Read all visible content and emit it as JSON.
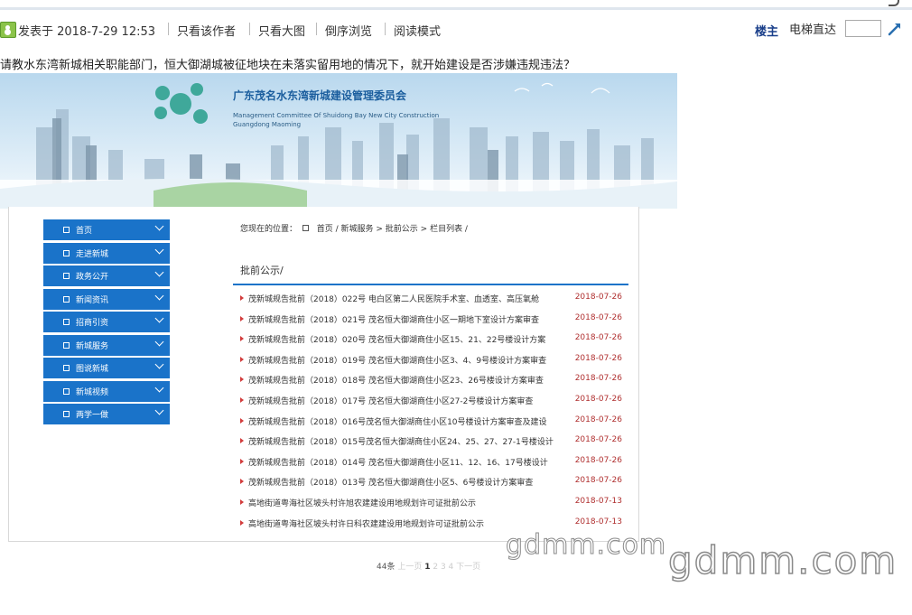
{
  "post": {
    "posted": "发表于 2018-7-29 12:53",
    "links": [
      "只看该作者",
      "只看大图",
      "倒序浏览",
      "阅读模式"
    ],
    "owner": "楼主",
    "lift_label": "电梯直达",
    "lift_value": "",
    "title": "请教水东湾新城相关职能部门，恒大御湖城被征地块在未落实留用地的情况下，就开始建设是否涉嫌违规违法？"
  },
  "icons": {
    "post": "post-user-icon",
    "go": "jump-arrow-icon",
    "nav_square": "square-bullet-icon",
    "nav_chevron": "chevron-down-icon",
    "row_arrow": "triangle-bullet-icon"
  },
  "banner": {
    "org_name_cn": "广东茂名水东湾新城建设管理委员会",
    "org_name_en_1": "Management Committee Of Shuidong Bay New City Construction",
    "org_name_en_2": "Guangdong Maoming"
  },
  "nav": {
    "items": [
      {
        "label": "首页"
      },
      {
        "label": "走进新城"
      },
      {
        "label": "政务公开"
      },
      {
        "label": "新闻资讯"
      },
      {
        "label": "招商引资"
      },
      {
        "label": "新城服务"
      },
      {
        "label": "图说新城"
      },
      {
        "label": "新城视频"
      },
      {
        "label": "两学一做"
      }
    ]
  },
  "breadcrumb": {
    "prefix": "您现在的位置：",
    "home": "首页",
    "path": "/ 新城服务 > 批前公示 > 栏目列表 /"
  },
  "section": {
    "title": "批前公示/"
  },
  "list": [
    {
      "title": "茂新城规告批前（2018）022号 电白区第二人民医院手术室、血透室、高压氧舱",
      "date": "2018-07-26"
    },
    {
      "title": "茂新城规告批前（2018）021号 茂名恒大御湖商住小区一期地下室设计方案审查",
      "date": "2018-07-26"
    },
    {
      "title": "茂新城规告批前（2018）020号 茂名恒大御湖商住小区15、21、22号楼设计方案",
      "date": "2018-07-26"
    },
    {
      "title": "茂新城规告批前（2018）019号 茂名恒大御湖商住小区3、4、9号楼设计方案审查",
      "date": "2018-07-26"
    },
    {
      "title": "茂新城规告批前（2018）018号 茂名恒大御湖商住小区23、26号楼设计方案审查",
      "date": "2018-07-26"
    },
    {
      "title": "茂新城规告批前（2018）017号 茂名恒大御湖商住小区27-2号楼设计方案审查",
      "date": "2018-07-26"
    },
    {
      "title": "茂新城规告批前（2018）016号茂名恒大御湖商住小区10号楼设计方案审查及建设",
      "date": "2018-07-26"
    },
    {
      "title": "茂新城规告批前（2018）015号茂名恒大御湖商住小区24、25、27、27-1号楼设计",
      "date": "2018-07-26"
    },
    {
      "title": "茂新城规告批前（2018）014号 茂名恒大御湖商住小区11、12、16、17号楼设计",
      "date": "2018-07-26"
    },
    {
      "title": "茂新城规告批前（2018）013号 茂名恒大御湖商住小区5、6号楼设计方案审查",
      "date": "2018-07-26"
    },
    {
      "title": "高地街道粤海社区坡头村许旭农建建设用地规划许可证批前公示",
      "date": "2018-07-13"
    },
    {
      "title": "高地街道粤海社区坡头村许日科农建建设用地规划许可证批前公示",
      "date": "2018-07-13"
    }
  ],
  "pager": {
    "count": "44条",
    "prev": "上一页",
    "current": "1",
    "pages": "2 3 4",
    "next": "下一页"
  },
  "watermarks": [
    "gdmm.com",
    "gdmm.com"
  ],
  "colors": {
    "nav": "#1a73c9",
    "date": "#b03030",
    "owner": "#1a3f8a"
  }
}
